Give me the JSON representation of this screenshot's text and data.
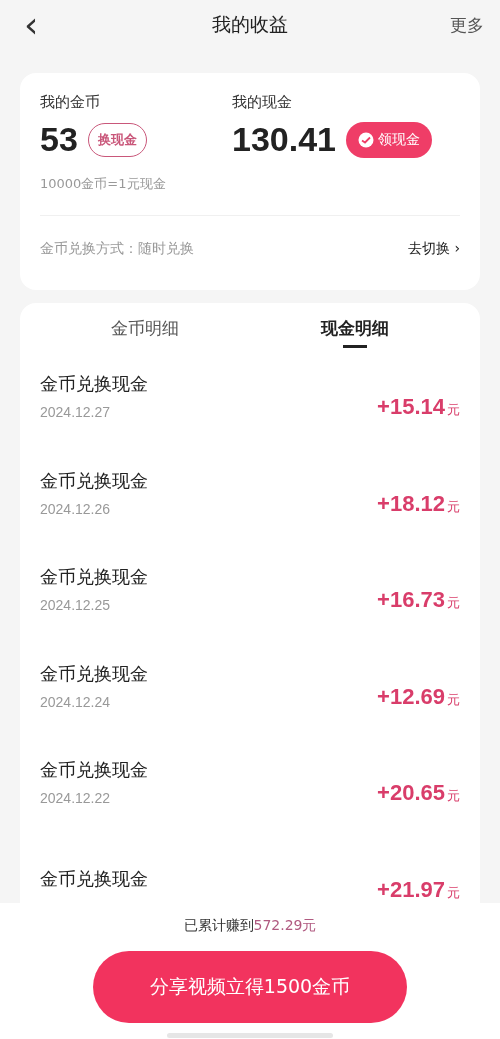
{
  "header": {
    "back_icon": "‹",
    "title": "我的收益",
    "more": "更多"
  },
  "summary": {
    "coins_label": "我的金币",
    "coins": "53",
    "coins_button": "换现金",
    "cash_label": "我的现金",
    "cash": "130.41",
    "cash_button": "领现金",
    "rate": "10000金币=1元现金",
    "method": "金币兑换方式：随时兑换",
    "switch_link": "去切换",
    "switch_arrow": "›"
  },
  "tabs": [
    {
      "label": "金币明细",
      "selected": false
    },
    {
      "label": "现金明细",
      "selected": true
    }
  ],
  "records": [
    {
      "title": "金币兑换现金",
      "date": "2024.12.27",
      "amount": "+15.14",
      "unit": "元"
    },
    {
      "title": "金币兑换现金",
      "date": "2024.12.26",
      "amount": "+18.12",
      "unit": "元"
    },
    {
      "title": "金币兑换现金",
      "date": "2024.12.25",
      "amount": "+16.73",
      "unit": "元"
    },
    {
      "title": "金币兑换现金",
      "date": "2024.12.24",
      "amount": "+12.69",
      "unit": "元"
    },
    {
      "title": "金币兑换现金",
      "date": "2024.12.22",
      "amount": "+20.65",
      "unit": "元"
    },
    {
      "title": "金币兑换现金",
      "amount": "+21.97",
      "unit": "元"
    }
  ],
  "footer": {
    "total_label": "已累计赚到",
    "total": "572.29元",
    "share_button": "分享视频立得1500金币"
  }
}
